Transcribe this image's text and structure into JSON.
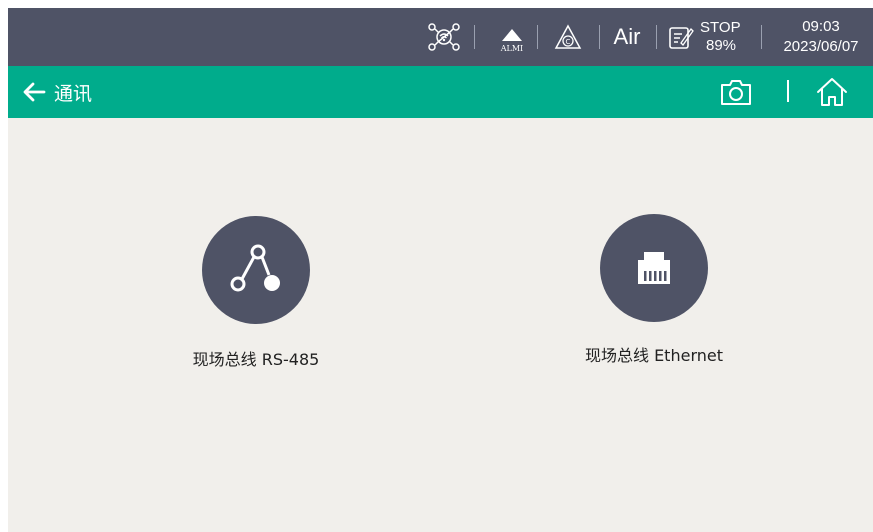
{
  "status_bar": {
    "network_icon": "network-icon",
    "alarm_icon": "alarm-triangle-icon",
    "alarm_label": "ALMI",
    "calibration_icon": "calibration-triangle-icon",
    "medium": "Air",
    "edit_icon": "edit-note-icon",
    "run_state": "STOP",
    "level": "89%",
    "time": "09:03",
    "date": "2023/06/07"
  },
  "title_bar": {
    "back_icon": "arrow-left-icon",
    "title": "通讯",
    "camera_icon": "camera-icon",
    "home_icon": "home-icon"
  },
  "items": [
    {
      "icon": "network-nodes-icon",
      "label": "现场总线 RS-485"
    },
    {
      "icon": "ethernet-port-icon",
      "label": "现场总线 Ethernet"
    }
  ],
  "colors": {
    "status_bg": "#4f5366",
    "title_bg": "#00ac8c",
    "content_bg": "#f1efeb",
    "circle_bg": "#4f5366"
  }
}
